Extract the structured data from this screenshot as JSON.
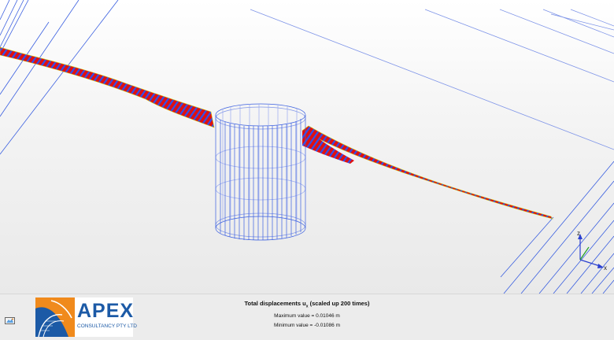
{
  "result": {
    "title": "Total displacements u",
    "component": "x",
    "scale_note": "(scaled up 200 times)",
    "max_line": "Maximum value = 0.01046 m",
    "min_line": "Minimum value = -0.01086 m"
  },
  "axes": {
    "z_label": "z",
    "x_label": "x"
  },
  "logo": {
    "name": "APEX",
    "tagline": "CONSULTANCY PTY LTD"
  },
  "colors": {
    "mesh_line": "#3a5fe0",
    "mesh_faint": "#7f95e8",
    "displacement_high": "#e01010",
    "displacement_low": "#3050ee",
    "logo_blue": "#1c5aa6",
    "logo_orange": "#f08a1c"
  },
  "icons": {
    "tool": "view-settings-icon"
  }
}
